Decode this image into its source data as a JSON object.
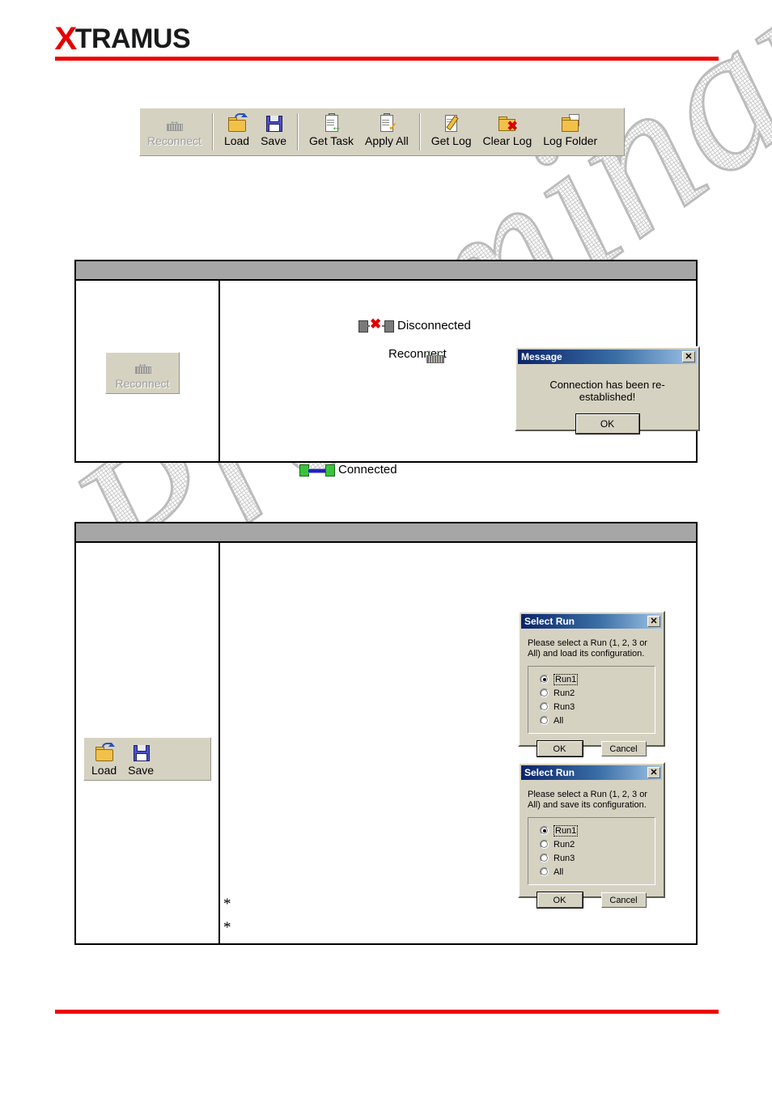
{
  "header": {
    "logo_x": "X",
    "logo_text": "TRAMUS"
  },
  "main_toolbar": {
    "buttons": [
      {
        "label": "Reconnect",
        "icon": "reconnect-icon",
        "enabled": false
      },
      {
        "label": "Load",
        "icon": "folder-open-icon",
        "enabled": true
      },
      {
        "label": "Save",
        "icon": "floppy-disk-icon",
        "enabled": true
      },
      {
        "label": "Get Task",
        "icon": "clipboard-get-icon",
        "enabled": true
      },
      {
        "label": "Apply All",
        "icon": "clipboard-check-icon",
        "enabled": true
      },
      {
        "label": "Get Log",
        "icon": "pencil-page-icon",
        "enabled": true
      },
      {
        "label": "Clear Log",
        "icon": "folder-delete-icon",
        "enabled": true
      },
      {
        "label": "Log Folder",
        "icon": "folder-document-icon",
        "enabled": true
      }
    ]
  },
  "loadsave_toolbar": {
    "buttons": [
      {
        "label": "Load",
        "icon": "folder-open-icon"
      },
      {
        "label": "Save",
        "icon": "floppy-disk-icon"
      }
    ]
  },
  "table1": {
    "header": "",
    "left_cell": {
      "button_label": "Reconnect",
      "button_enabled": false
    },
    "right_cell": {
      "status_disconnected": "Disconnected",
      "status_connected": "Connected",
      "reconnect_label": "Reconnect"
    }
  },
  "table2": {
    "header": "",
    "notes": [
      "*",
      "*"
    ]
  },
  "message_dialog": {
    "title": "Message",
    "close_label": "✕",
    "text": "Connection has been re-established!",
    "ok_label": "OK"
  },
  "selectrun_load": {
    "title": "Select Run",
    "close_label": "✕",
    "instruction": "Please select a Run (1, 2, 3 or All) and load its configuration.",
    "options": [
      {
        "label": "Run1",
        "selected": true
      },
      {
        "label": "Run2",
        "selected": false
      },
      {
        "label": "Run3",
        "selected": false
      },
      {
        "label": "All",
        "selected": false
      }
    ],
    "ok_label": "OK",
    "cancel_label": "Cancel"
  },
  "selectrun_save": {
    "title": "Select Run",
    "close_label": "✕",
    "instruction": "Please select a Run (1, 2, 3 or All) and save its configuration.",
    "options": [
      {
        "label": "Run1",
        "selected": true
      },
      {
        "label": "Run2",
        "selected": false
      },
      {
        "label": "Run3",
        "selected": false
      },
      {
        "label": "All",
        "selected": false
      }
    ],
    "ok_label": "OK",
    "cancel_label": "Cancel"
  },
  "watermark": {
    "text": "Preliminary"
  },
  "colors": {
    "brand_red": "#ee0000",
    "table_header_grey": "#a6a6a6",
    "titlebar_blue": "#0a246a",
    "toolbar_face": "#d6d2c2"
  }
}
